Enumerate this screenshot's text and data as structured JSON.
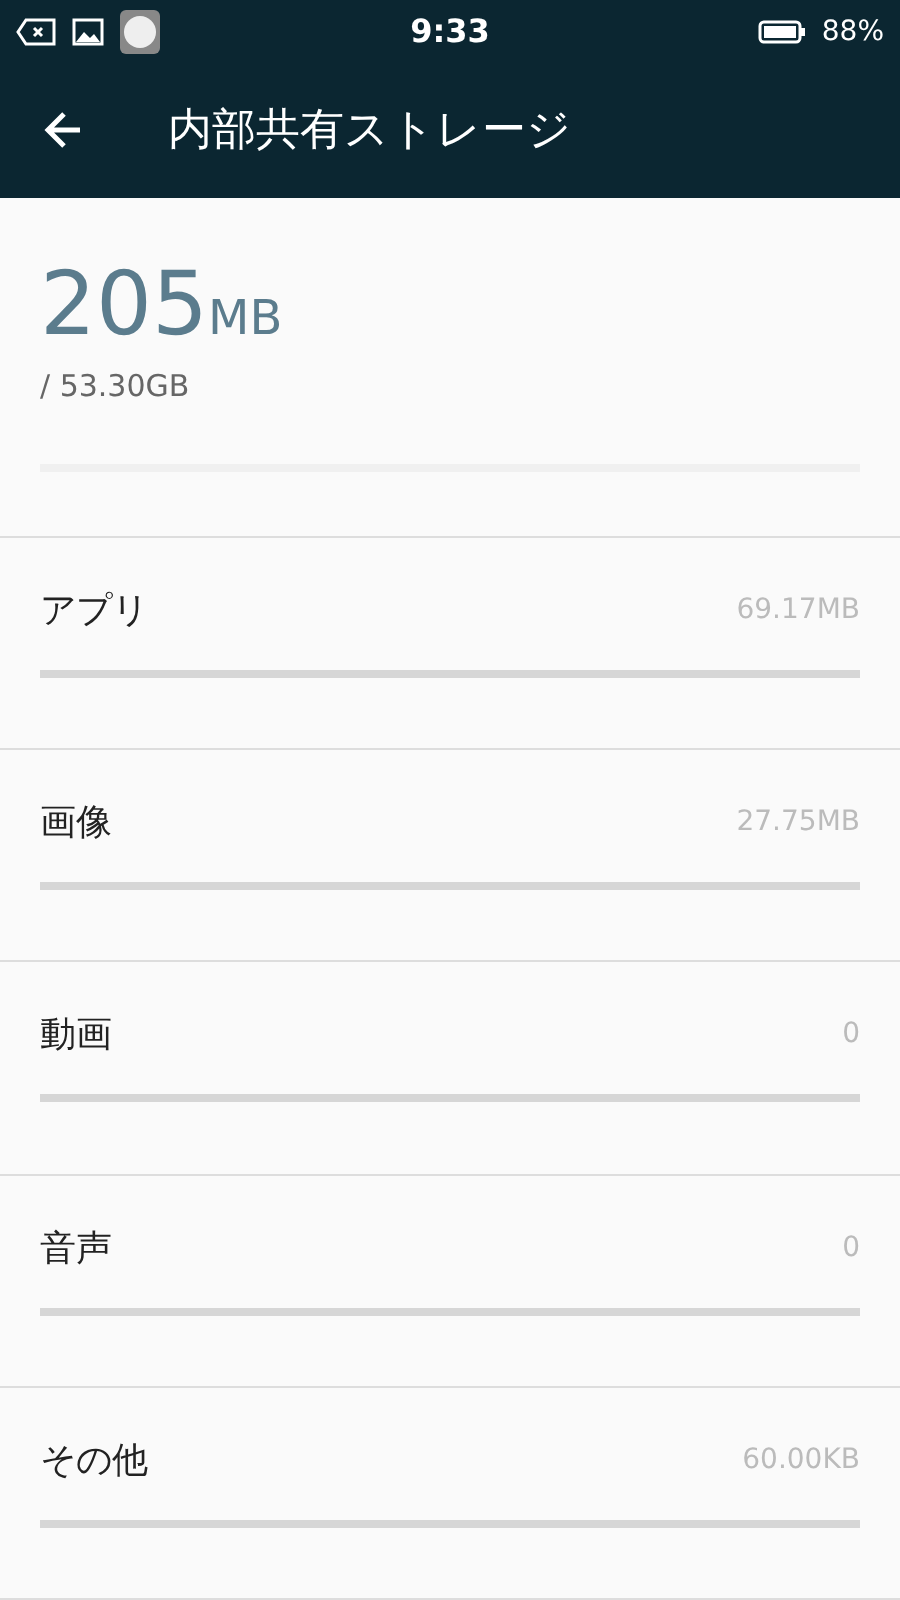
{
  "status_bar": {
    "time": "9:33",
    "battery": "88%"
  },
  "app_bar": {
    "title": "内部共有ストレージ"
  },
  "summary": {
    "used_value": "205",
    "used_unit": "MB",
    "total": "/ 53.30GB",
    "level": 0
  },
  "categories": [
    {
      "label": "アプリ",
      "size": "69.17MB",
      "level": 0
    },
    {
      "label": "画像",
      "size": "27.75MB",
      "level": 0
    },
    {
      "label": "動画",
      "size": "0",
      "level": 0
    },
    {
      "label": "音声",
      "size": "0",
      "level": 0
    },
    {
      "label": "その他",
      "size": "60.00KB",
      "level": 0
    }
  ]
}
